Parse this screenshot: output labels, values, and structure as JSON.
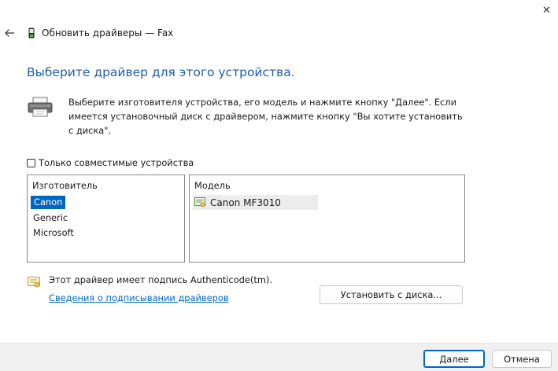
{
  "window": {
    "title": "Обновить драйверы — Fax",
    "close_glyph": "✕",
    "back_glyph": "←"
  },
  "main": {
    "heading": "Выберите драйвер для этого устройства.",
    "instructions": "Выберите изготовителя устройства, его модель и нажмите кнопку \"Далее\". Если имеется установочный диск с драйвером, нажмите кнопку \"Вы хотите установить с диска\".",
    "compatible_only": {
      "label": "Только совместимые устройства",
      "checked": false
    }
  },
  "manufacturers": {
    "header": "Изготовитель",
    "items": [
      "Canon",
      "Generic",
      "Microsoft"
    ],
    "selected_index": 0
  },
  "models": {
    "header": "Модель",
    "items": [
      "Canon MF3010"
    ]
  },
  "signature": {
    "text": "Этот драйвер имеет подпись Authenticode(tm).",
    "link": "Сведения о подписывании драйверов"
  },
  "buttons": {
    "have_disk": "Установить с диска...",
    "next": "Далее",
    "cancel": "Отмена"
  },
  "colors": {
    "heading": "#1f5ea8",
    "selection": "#0067c0",
    "link": "#0066cc",
    "footer": "#f0f0f0"
  }
}
